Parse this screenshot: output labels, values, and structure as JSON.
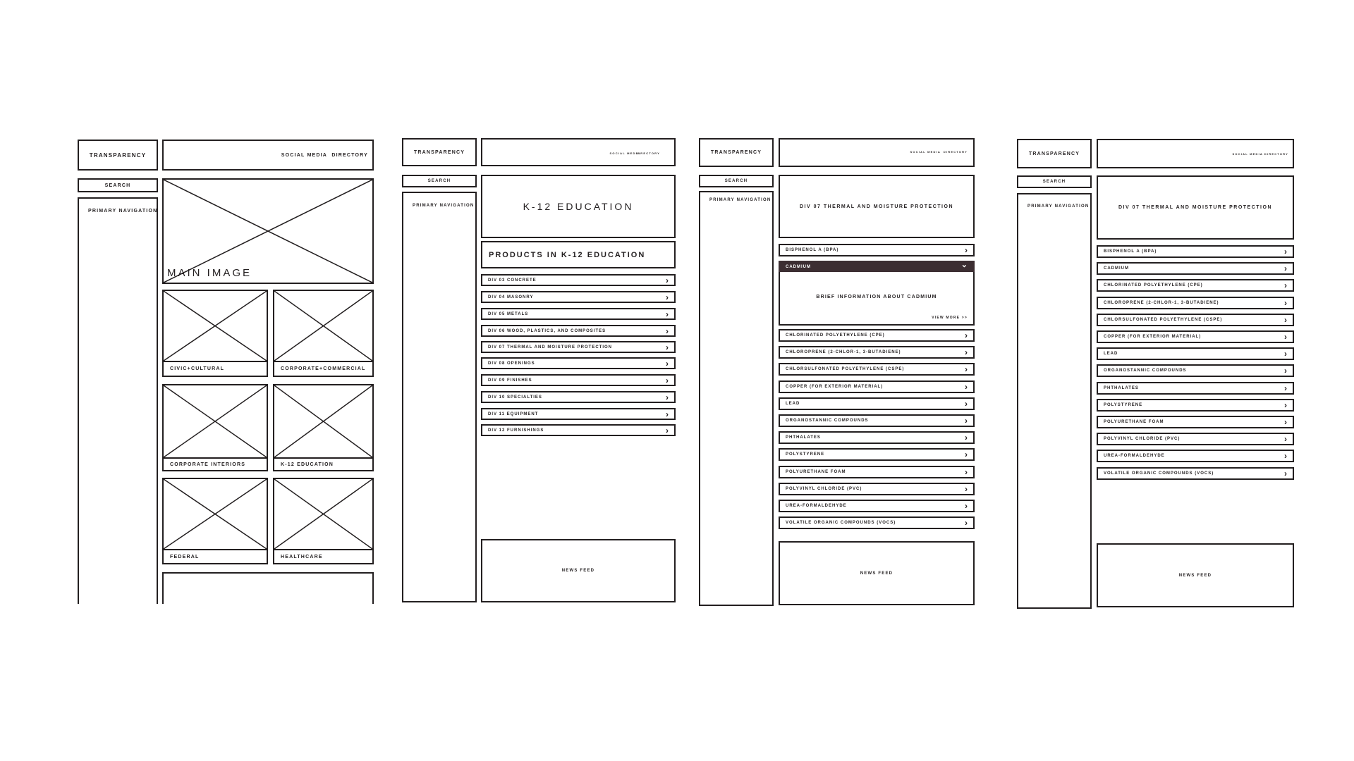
{
  "common": {
    "brand": "TRANSPARENCY",
    "search": "SEARCH",
    "primary_nav": "PRIMARY NAVIGATION",
    "social_media": "SOCIAL MEDIA",
    "directory": "DIRECTORY",
    "news_feed": "NEWS FEED",
    "chevron_right": "›",
    "chevron_down": "⌄"
  },
  "home": {
    "main_image": "MAIN IMAGE",
    "tiles": [
      "CIVIC+CULTURAL",
      "CORPORATE+COMMERCIAL",
      "CORPORATE INTERIORS",
      "K-12 EDUCATION",
      "FEDERAL",
      "HEALTHCARE"
    ]
  },
  "sector": {
    "title": "K-12 EDUCATION",
    "products_title": "PRODUCTS IN K-12 EDUCATION",
    "divisions": [
      "DIV 03 CONCRETE",
      "DIV 04 MASONRY",
      "DIV 05 METALS",
      "DIV 06 WOOD, PLASTICS, AND COMPOSITES",
      "DIV 07 THERMAL AND MOISTURE PROTECTION",
      "DIV 08 OPENINGS",
      "DIV 09 FINISHES",
      "DIV 10 SPECIALTIES",
      "DIV 11 EQUIPMENT",
      "DIV 12 FURNISHINGS"
    ]
  },
  "division_expanded": {
    "title": "DIV 07 THERMAL AND MOISTURE PROTECTION",
    "first_item": "BISPHENOL A (BPA)",
    "expanded_item": "CADMIUM",
    "expanded_info": "BRIEF INFORMATION ABOUT CADMIUM",
    "view_more": "VIEW MORE >>",
    "rest_items": [
      "CHLORINATED POLYETHYLENE (CPE)",
      "CHLOROPRENE (2-CHLOR-1, 3-BUTADIENE)",
      "CHLORSULFONATED POLYETHYLENE (CSPE)",
      "COPPER (FOR EXTERIOR MATERIAL)",
      "LEAD",
      "ORGANOSTANNIC COMPOUNDS",
      "PHTHALATES",
      "POLYSTYRENE",
      "POLYURETHANE FOAM",
      "POLYVINYL CHLORIDE (PVC)",
      "UREA-FORMALDEHYDE",
      "VOLATILE ORGANIC COMPOUNDS (VOCS)"
    ]
  },
  "division_list": {
    "title": "DIV 07 THERMAL AND MOISTURE PROTECTION",
    "items": [
      "BISPHENOL A (BPA)",
      "CADMIUM",
      "CHLORINATED POLYETHYLENE (CPE)",
      "CHLOROPRENE (2-CHLOR-1, 3-BUTADIENE)",
      "CHLORSULFONATED POLYETHYLENE (CSPE)",
      "COPPER (FOR EXTERIOR MATERIAL)",
      "LEAD",
      "ORGANOSTANNIC COMPOUNDS",
      "PHTHALATES",
      "POLYSTYRENE",
      "POLYURETHANE FOAM",
      "POLYVINYL CHLORIDE (PVC)",
      "UREA-FORMALDEHYDE",
      "VOLATILE ORGANIC COMPOUNDS (VOCS)"
    ]
  },
  "colors": {
    "line": "#231f20",
    "accent": "#3c2e32",
    "background": "#ffffff"
  }
}
